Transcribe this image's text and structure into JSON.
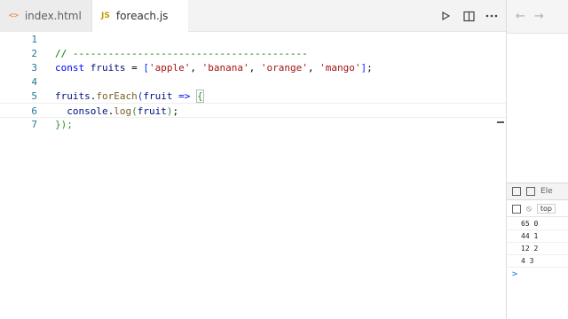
{
  "tabs": [
    {
      "icon": "<>",
      "label": "index.html"
    },
    {
      "icon": "JS",
      "label": "foreach.js"
    }
  ],
  "code_lines": [
    {
      "num": "1"
    },
    {
      "num": "2",
      "comment": "// ----------------------------------------"
    },
    {
      "num": "3",
      "kw": "const",
      "name": "fruits",
      "op": " = ",
      "items": [
        "'apple'",
        "'banana'",
        "'orange'",
        "'mango'"
      ]
    },
    {
      "num": "4"
    },
    {
      "num": "5",
      "obj": "fruits",
      "method": "forEach",
      "param": "fruit",
      "arrow": "=>"
    },
    {
      "num": "6",
      "obj": "console",
      "method": "log",
      "arg": "fruit"
    },
    {
      "num": "7",
      "close": "});"
    }
  ],
  "browser": {
    "back": "←",
    "forward": "→"
  },
  "devtools": {
    "tab_label": "Ele",
    "context": "top",
    "logs": [
      {
        "value": "65",
        "index": "0"
      },
      {
        "value": "44",
        "index": "1"
      },
      {
        "value": "12",
        "index": "2"
      },
      {
        "value": "4",
        "index": "3"
      }
    ],
    "prompt": ">"
  }
}
